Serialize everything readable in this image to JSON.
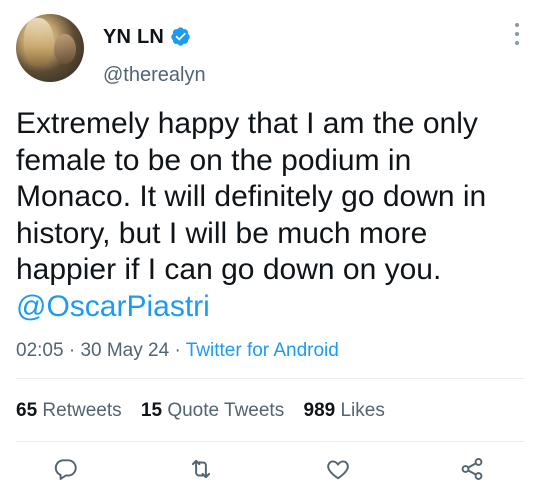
{
  "author": {
    "name": "YN LN",
    "handle": "@therealyn",
    "verified": true
  },
  "tweet": {
    "text_main": "Extremely happy that I am the only female to be on the podium in Monaco. It will definitely go down in history, but I will be much more happier if I can go down on you.",
    "mention": "@OscarPiastri"
  },
  "meta": {
    "time": "02:05",
    "sep1": " · ",
    "date": "30 May 24",
    "sep2": " · ",
    "source": "Twitter for Android"
  },
  "stats": {
    "retweets_count": "65",
    "retweets_label": "Retweets",
    "quotes_count": "15",
    "quotes_label": "Quote Tweets",
    "likes_count": "989",
    "likes_label": "Likes"
  },
  "icons": {
    "reply": "reply-icon",
    "retweet": "retweet-icon",
    "like": "like-icon",
    "share": "share-icon",
    "more": "more-options-icon",
    "verified": "verified-badge-icon"
  },
  "colors": {
    "text": "#0f1419",
    "secondary": "#536471",
    "link": "#1d9bf0",
    "divider": "#e6ecf0"
  }
}
